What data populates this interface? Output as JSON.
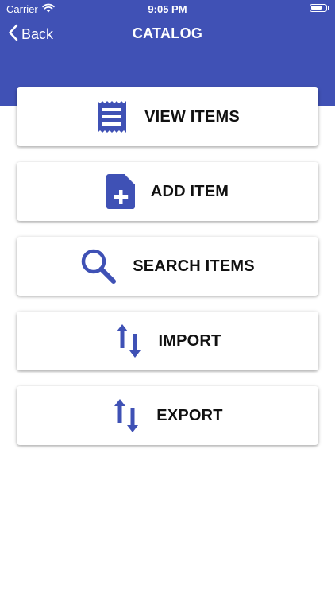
{
  "status_bar": {
    "carrier": "Carrier",
    "time": "9:05 PM",
    "battery_level": 0.8
  },
  "nav": {
    "back_label": "Back",
    "title": "CATALOG"
  },
  "colors": {
    "brand": "#4051b5",
    "icon": "#3f51b5",
    "label": "#111111"
  },
  "menu": {
    "items": [
      {
        "label": "VIEW ITEMS",
        "icon": "receipt-list-icon"
      },
      {
        "label": "ADD ITEM",
        "icon": "file-plus-icon"
      },
      {
        "label": "SEARCH ITEMS",
        "icon": "search-icon"
      },
      {
        "label": "IMPORT",
        "icon": "swap-vertical-icon"
      },
      {
        "label": "EXPORT",
        "icon": "swap-vertical-icon"
      }
    ]
  }
}
